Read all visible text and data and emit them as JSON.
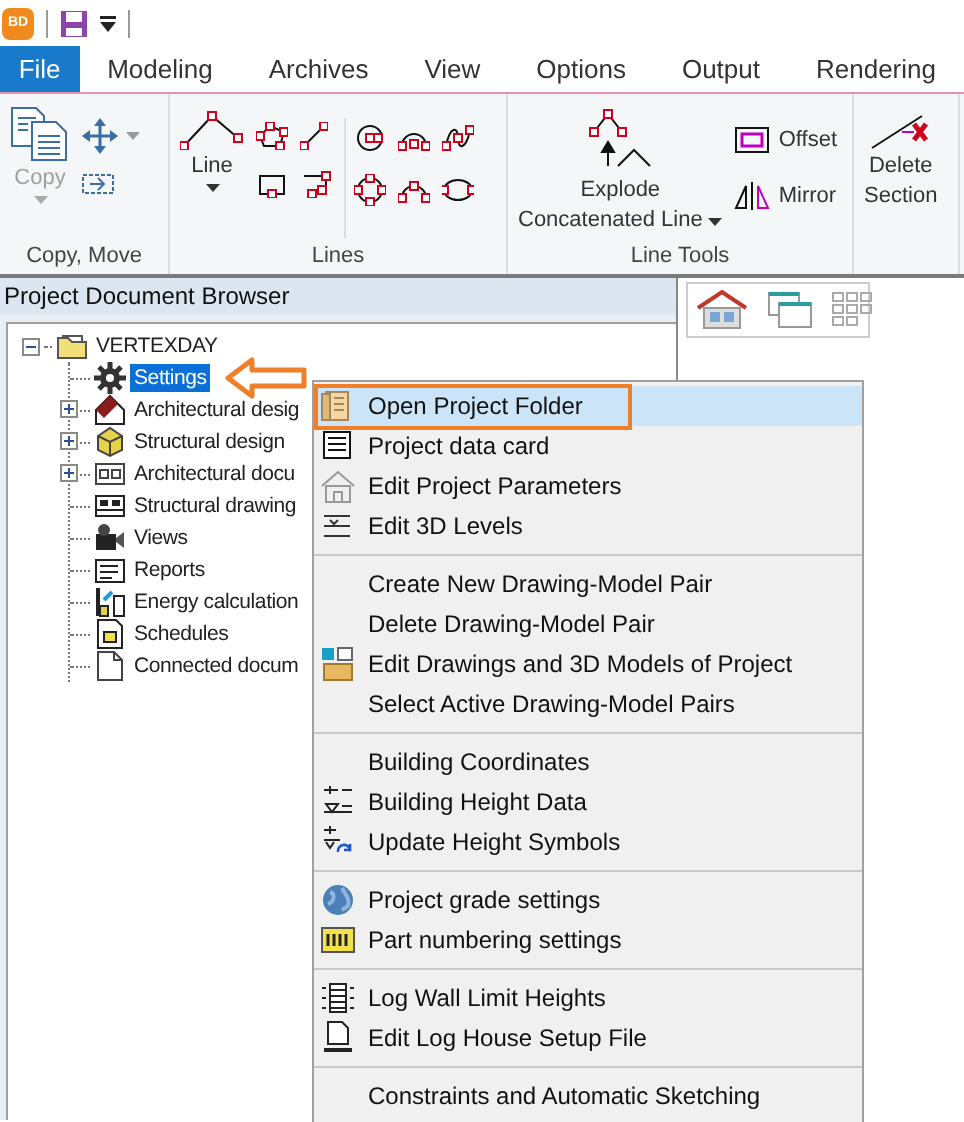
{
  "app_icon": {
    "label": "BD"
  },
  "tabs": [
    {
      "label": "File",
      "selected": true
    },
    {
      "label": "Modeling",
      "selected": false
    },
    {
      "label": "Archives",
      "selected": false
    },
    {
      "label": "View",
      "selected": false
    },
    {
      "label": "Options",
      "selected": false
    },
    {
      "label": "Output",
      "selected": false
    },
    {
      "label": "Rendering",
      "selected": false
    }
  ],
  "ribbon": {
    "copy_move": {
      "label": "Copy, Move",
      "copy": {
        "label": "Copy",
        "disabled": true
      }
    },
    "lines": {
      "label": "Lines",
      "line": {
        "label": "Line"
      }
    },
    "line_tools": {
      "label": "Line Tools",
      "explode": {
        "label_lines": [
          "Explode",
          "Concatenated Line"
        ]
      },
      "offset": {
        "label": "Offset"
      },
      "mirror": {
        "label": "Mirror"
      }
    },
    "delete_section": {
      "label_lines": [
        "Delete",
        "Section"
      ]
    }
  },
  "browser": {
    "title": "Project Document Browser",
    "tree": [
      {
        "label": "VERTEXDAY",
        "selected": false,
        "expanded": true,
        "children": [
          {
            "label": "Settings",
            "selected": true
          },
          {
            "label": "Architectural desig",
            "selected": false,
            "expanded": false
          },
          {
            "label": "Structural design",
            "selected": false,
            "expanded": false
          },
          {
            "label": "Architectural docu",
            "selected": false,
            "expanded": false
          },
          {
            "label": "Structural drawing",
            "selected": false
          },
          {
            "label": "Views",
            "selected": false
          },
          {
            "label": "Reports",
            "selected": false
          },
          {
            "label": "Energy calculation",
            "selected": false
          },
          {
            "label": "Schedules",
            "selected": false
          },
          {
            "label": "Connected docum",
            "selected": false
          }
        ]
      }
    ]
  },
  "context_menu": {
    "sections": [
      [
        {
          "label": "Open Project Folder",
          "selected": true
        },
        {
          "label": "Project data card",
          "selected": false
        },
        {
          "label": "Edit Project Parameters",
          "selected": false
        },
        {
          "label": "Edit 3D Levels",
          "selected": false
        }
      ],
      [
        {
          "label": "Create New Drawing-Model Pair",
          "selected": false
        },
        {
          "label": "Delete Drawing-Model Pair",
          "selected": false
        },
        {
          "label": "Edit Drawings and 3D Models of Project",
          "selected": false
        },
        {
          "label": "Select Active Drawing-Model Pairs",
          "selected": false
        }
      ],
      [
        {
          "label": "Building Coordinates",
          "selected": false
        },
        {
          "label": "Building Height Data",
          "selected": false
        },
        {
          "label": "Update Height Symbols",
          "selected": false
        }
      ],
      [
        {
          "label": "Project grade settings",
          "selected": false
        },
        {
          "label": "Part numbering settings",
          "selected": false
        }
      ],
      [
        {
          "label": "Log Wall Limit Heights",
          "selected": false
        },
        {
          "label": "Edit Log House Setup File",
          "selected": false
        }
      ],
      [
        {
          "label": "Constraints and Automatic Sketching",
          "selected": false
        }
      ]
    ]
  }
}
